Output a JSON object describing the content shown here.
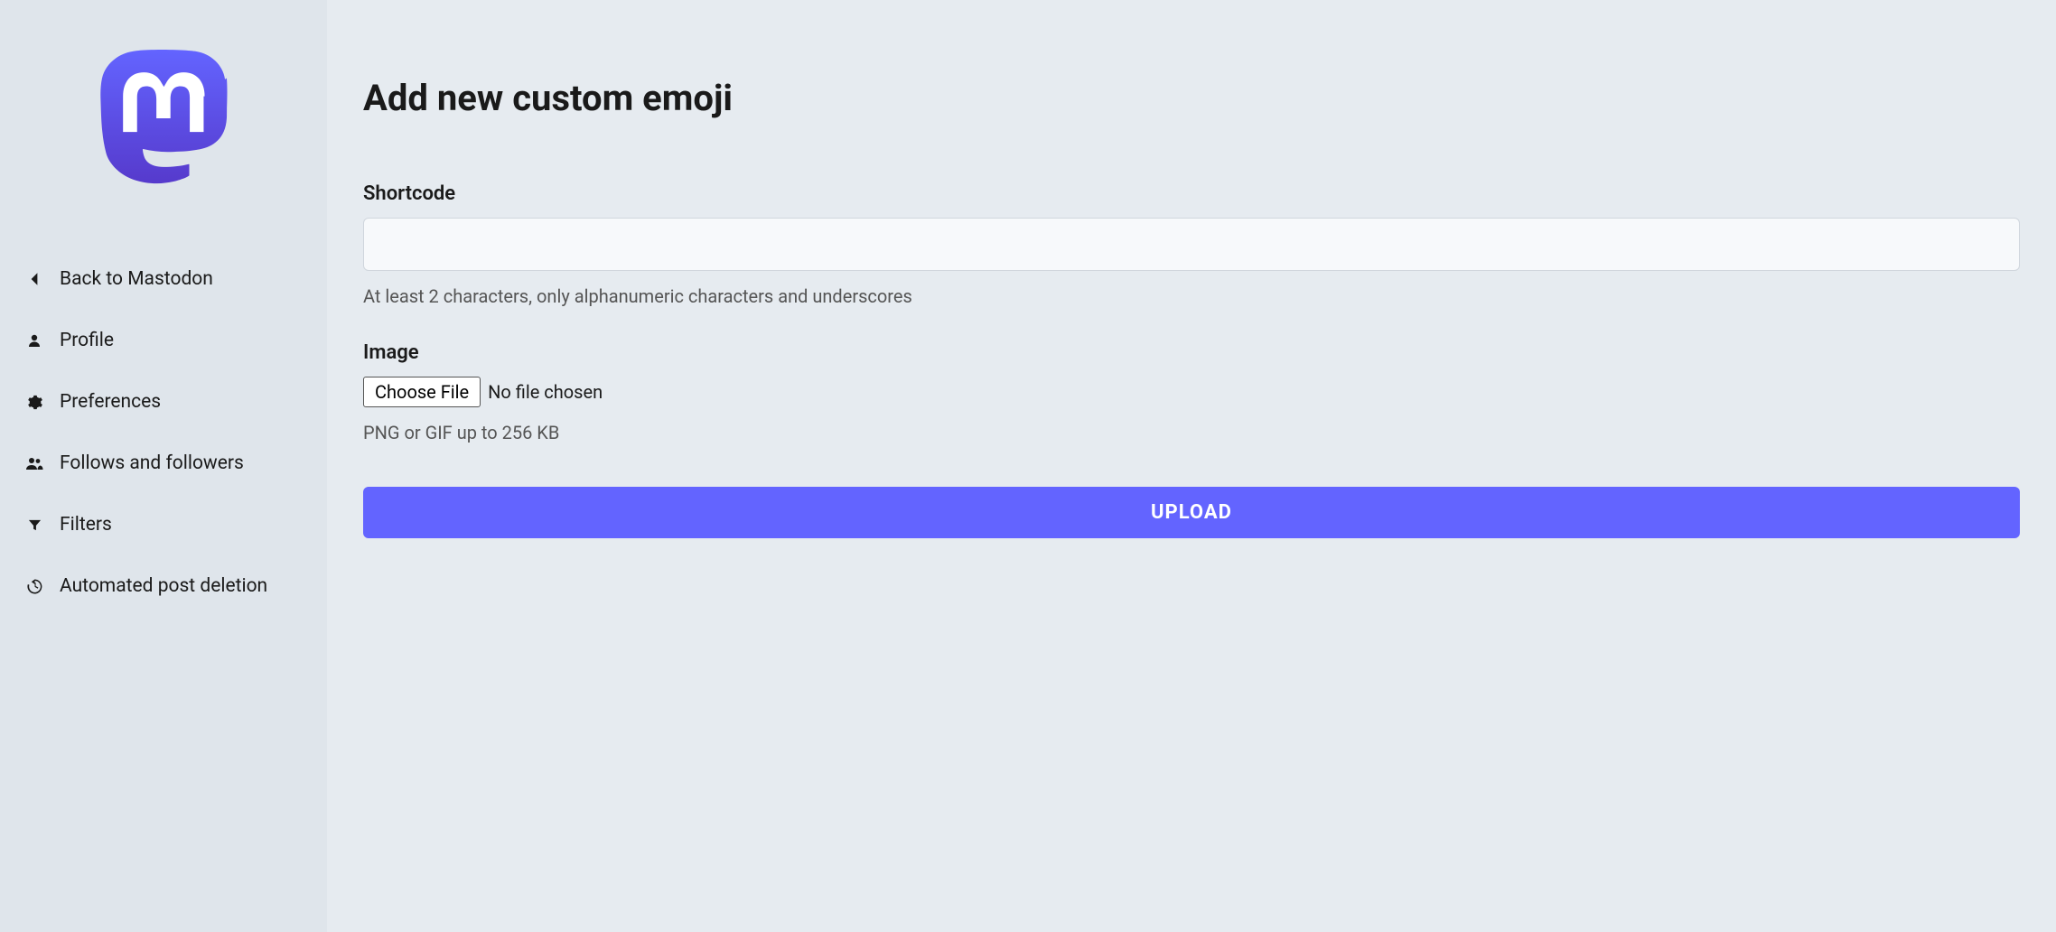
{
  "sidebar": {
    "items": [
      {
        "icon": "chevron-left-icon",
        "label": "Back to Mastodon"
      },
      {
        "icon": "user-icon",
        "label": "Profile"
      },
      {
        "icon": "gear-icon",
        "label": "Preferences"
      },
      {
        "icon": "users-icon",
        "label": "Follows and followers"
      },
      {
        "icon": "filter-icon",
        "label": "Filters"
      },
      {
        "icon": "history-icon",
        "label": "Automated post deletion"
      }
    ]
  },
  "main": {
    "title": "Add new custom emoji",
    "shortcode": {
      "label": "Shortcode",
      "value": "",
      "help": "At least 2 characters, only alphanumeric characters and underscores"
    },
    "image": {
      "label": "Image",
      "choose_button": "Choose File",
      "status": "No file chosen",
      "help": "PNG or GIF up to 256 KB"
    },
    "upload_button": "UPLOAD"
  },
  "colors": {
    "brand": "#6364ff"
  }
}
